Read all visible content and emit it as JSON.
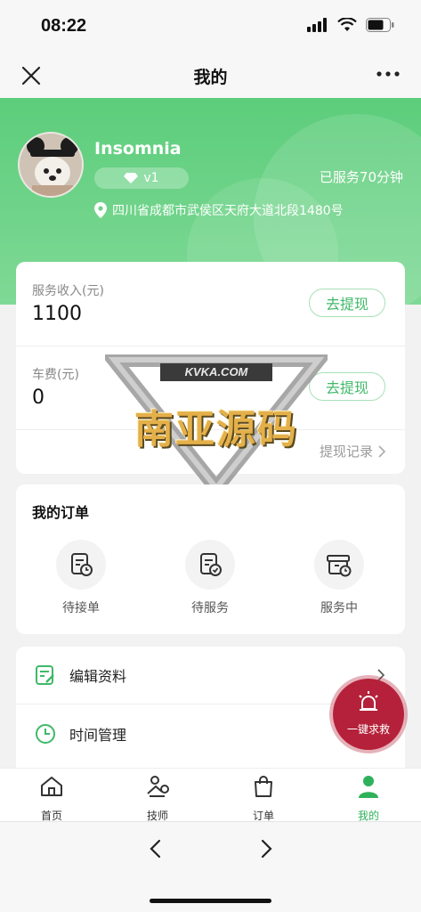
{
  "status_bar": {
    "time": "08:22"
  },
  "nav": {
    "title": "我的"
  },
  "profile": {
    "username": "Insomnia",
    "level": "v1",
    "served_text": "已服务70分钟",
    "address": "四川省成都市武侯区天府大道北段1480号"
  },
  "income": {
    "service_label": "服务收入(元)",
    "service_value": "1100",
    "withdraw_label": "去提现",
    "fare_label": "车费(元)",
    "fare_value": "0",
    "fare_withdraw_label": "去提现",
    "record_label": "提现记录"
  },
  "orders": {
    "title": "我的订单",
    "items": [
      {
        "label": "待接单",
        "icon": "pending-order-icon"
      },
      {
        "label": "待服务",
        "icon": "to-serve-icon"
      },
      {
        "label": "服务中",
        "icon": "in-service-icon"
      }
    ]
  },
  "menu": {
    "items": [
      {
        "label": "编辑资料",
        "icon": "edit-profile-icon"
      },
      {
        "label": "时间管理",
        "icon": "clock-icon"
      }
    ]
  },
  "sos": {
    "label": "一键求救"
  },
  "tabs": [
    {
      "label": "首页",
      "icon": "home-icon"
    },
    {
      "label": "技师",
      "icon": "technician-icon"
    },
    {
      "label": "订单",
      "icon": "shopping-bag-icon"
    },
    {
      "label": "我的",
      "icon": "person-icon",
      "active": true
    }
  ],
  "watermark": {
    "domain": "KVKA.COM",
    "text": "南亚源码"
  },
  "colors": {
    "accent": "#2fb15b",
    "hero": "#5ccd7b",
    "sos": "#b5213a"
  }
}
